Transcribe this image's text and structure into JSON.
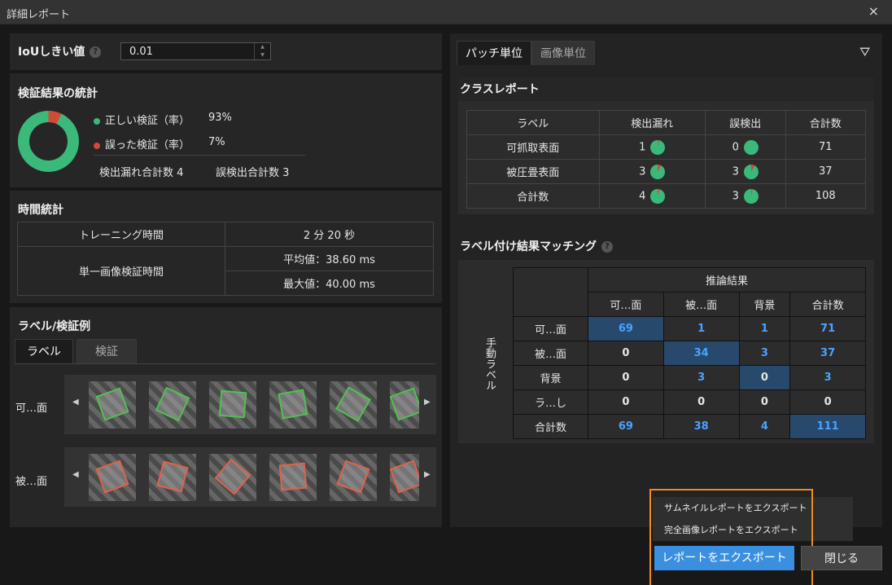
{
  "window": {
    "title": "詳細レポート",
    "close": "×"
  },
  "iou": {
    "label": "IoUしきい値",
    "value": "0.01"
  },
  "stats": {
    "title": "検証結果の統計",
    "correct_label": "正しい検証（率）",
    "correct_value": "93%",
    "wrong_label": "誤った検証（率）",
    "wrong_value": "7%",
    "missed": "検出漏れ合計数  4",
    "false_det": "誤検出合計数  3",
    "colors": {
      "correct": "#3ab97a",
      "wrong": "#d24a3a"
    }
  },
  "time": {
    "title": "時間統計",
    "train_label": "トレーニング時間",
    "train_value": "2 分 20 秒",
    "single_label": "単一画像検証時間",
    "avg": "平均値：38.60 ms",
    "max": "最大値：40.00 ms"
  },
  "examples": {
    "title": "ラベル/検証例",
    "tabs": [
      "ラベル",
      "検証"
    ],
    "rows": [
      {
        "label": "可…面",
        "color": "#4fc04f"
      },
      {
        "label": "被…面",
        "color": "#e0604a"
      }
    ]
  },
  "right_tabs": [
    "パッチ単位",
    "画像単位"
  ],
  "class_report": {
    "title": "クラスレポート",
    "headers": [
      "ラベル",
      "検出漏れ",
      "誤検出",
      "合計数"
    ],
    "rows": [
      {
        "label": "可抓取表面",
        "missed": "1",
        "fd": "0",
        "total": "71",
        "mpie": 0.02,
        "fpie": 0
      },
      {
        "label": "被圧畳表面",
        "missed": "3",
        "fd": "3",
        "total": "37",
        "mpie": 0.08,
        "fpie": 0.08
      },
      {
        "label": "合計数",
        "missed": "4",
        "fd": "3",
        "total": "108",
        "mpie": 0.04,
        "fpie": 0.03
      }
    ]
  },
  "matching": {
    "title": "ラベル付け結果マッチング",
    "infer": "推論結果",
    "manual": "手動ラベル",
    "cols": [
      "可…面",
      "被…面",
      "背景",
      "合計数"
    ],
    "rows": [
      {
        "label": "可…面",
        "cells": [
          "69",
          "1",
          "1",
          "71"
        ]
      },
      {
        "label": "被…面",
        "cells": [
          "0",
          "34",
          "3",
          "37"
        ]
      },
      {
        "label": "背景",
        "cells": [
          "0",
          "3",
          "0",
          "3"
        ]
      },
      {
        "label": "ラ…し",
        "cells": [
          "0",
          "0",
          "0",
          "0"
        ]
      },
      {
        "label": "合計数",
        "cells": [
          "69",
          "38",
          "4",
          "111"
        ]
      }
    ]
  },
  "menu": [
    "サムネイルレポートをエクスポート",
    "完全画像レポートをエクスポート"
  ],
  "buttons": {
    "export": "レポートをエクスポート",
    "close": "閉じる"
  }
}
